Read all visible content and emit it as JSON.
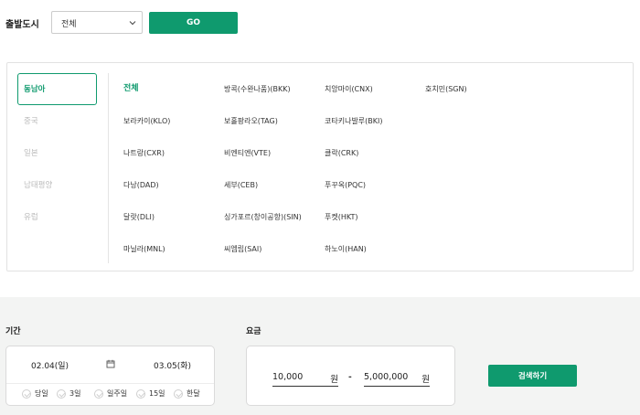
{
  "departure": {
    "label": "출발도시",
    "selected": "전체",
    "go_label": "GO"
  },
  "regions": [
    {
      "label": "동남아",
      "active": true
    },
    {
      "label": "중국",
      "active": false
    },
    {
      "label": "일본",
      "active": false
    },
    {
      "label": "남태평양",
      "active": false
    },
    {
      "label": "유럽",
      "active": false
    }
  ],
  "cities": [
    [
      "전체",
      "방콕(수완나품)(BKK)",
      "치앙마이(CNX)",
      "호치민(SGN)"
    ],
    [
      "보라카이(KLO)",
      "보홀팡라오(TAG)",
      "코타키나발루(BKI)"
    ],
    [
      "나트랑(CXR)",
      "비엔티엔(VTE)",
      "클락(CRK)"
    ],
    [
      "다낭(DAD)",
      "세부(CEB)",
      "푸꾸옥(PQC)"
    ],
    [
      "달랏(DLI)",
      "싱가포르(창이공항)(SIN)",
      "푸켓(HKT)"
    ],
    [
      "마닐라(MNL)",
      "씨엠립(SAI)",
      "하노이(HAN)"
    ]
  ],
  "period": {
    "label": "기간",
    "start_date": "02.04(일)",
    "end_date": "03.05(화)",
    "durations": [
      "당일",
      "3일",
      "일주일",
      "15일",
      "한달"
    ]
  },
  "price": {
    "label": "요금",
    "min": "10,000",
    "max": "5,000,000",
    "unit": "원",
    "separator": "-"
  },
  "search_label": "검색하기",
  "colors": {
    "accent": "#0f9a6e",
    "panel_bg": "#f3f4f3"
  }
}
